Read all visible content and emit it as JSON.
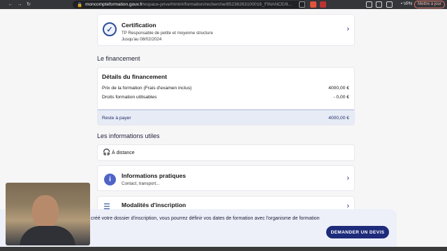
{
  "browser": {
    "url_host": "moncompteformation.gouv.fr",
    "url_path": "/espace-prive/html/#/formation/recherche/85236263100016_FINANCE/8...",
    "vpn_label": "• VPN",
    "update_label": "Mettre à jour"
  },
  "certification": {
    "title": "Certification",
    "name": "TP Responsable de petite et moyenne structure",
    "validity": "Jusqu'au 08/02/2024"
  },
  "financement": {
    "section_title": "Le financement",
    "details_title": "Détails du financement",
    "rows": [
      {
        "label": "Prix de la formation (Frais d'examen inclus)",
        "value": "4000,00 €"
      },
      {
        "label": "Droits formation utilisables",
        "value": "- 0,00 €"
      }
    ],
    "reste_label": "Reste à payer",
    "reste_value": "4000,00 €"
  },
  "infos": {
    "section_title": "Les informations utiles",
    "mode": "À distance",
    "pratiques_title": "Informations pratiques",
    "pratiques_sub": "Contact, transport...",
    "modalites_title": "Modalités d'inscription"
  },
  "cookie_banner": {
    "text": "créé votre dossier d'inscription, vous pourrez définir vos dates de formation avec l'organisme de formation",
    "button_label": "DEMANDER UN DEVIS"
  },
  "colors": {
    "accent": "#000091",
    "button": "#1d2b7a",
    "highlight": "#e6ebf5"
  }
}
